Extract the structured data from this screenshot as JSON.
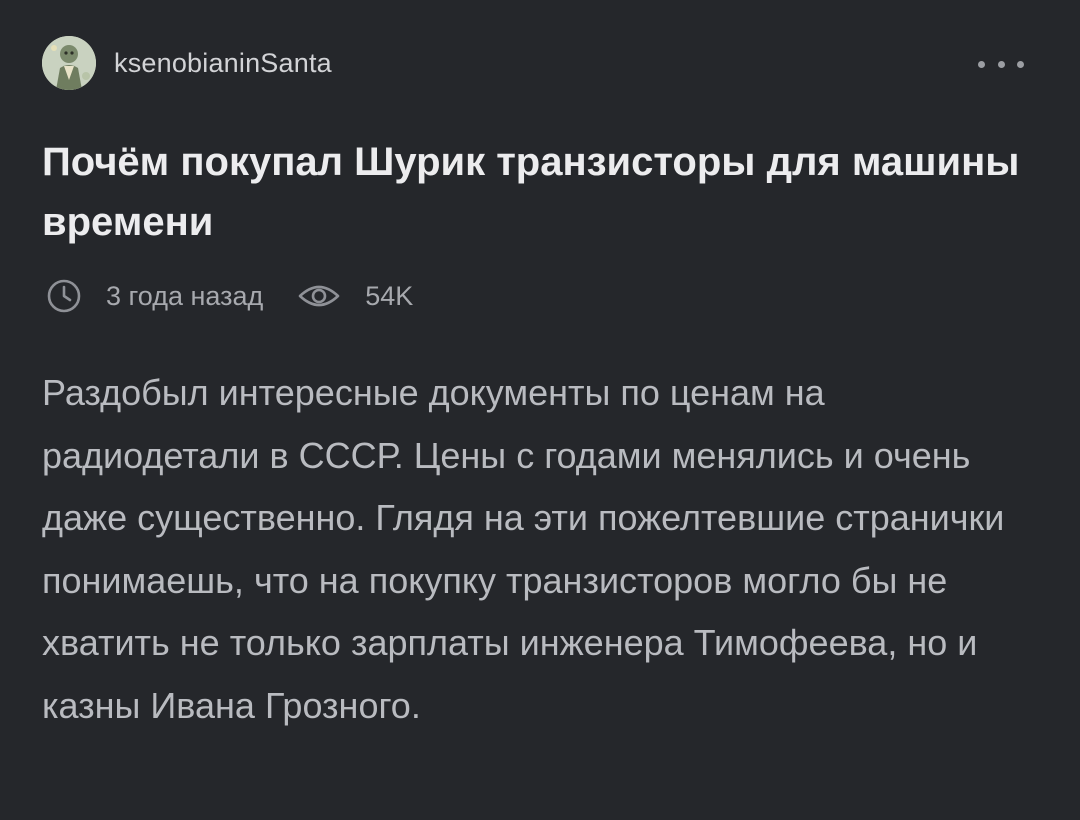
{
  "author": {
    "name": "ksenobianinSanta",
    "avatar_icon": "avatar-icon"
  },
  "menu": {
    "icon": "more-dots-icon"
  },
  "post": {
    "title": "Почём покупал Шурик транзисторы для машины времени",
    "time_icon": "clock-icon",
    "time_ago": "3 года назад",
    "views_icon": "eye-icon",
    "views": "54K",
    "body": "Раздобыл интересные документы по ценам на радиодетали в СССР. Цены с годами менялись и очень даже существенно. Глядя на эти пожелтевшие странички понимаешь, что на покупку транзисторов могло бы не хватить не только зарплаты инженера Тимофеева, но и казны Ивана Грозного."
  },
  "colors": {
    "background": "#25272b",
    "title": "#ececee",
    "body": "#b9bbc0",
    "meta": "#a7a9ae"
  }
}
